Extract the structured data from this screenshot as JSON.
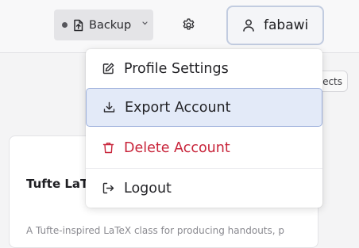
{
  "header": {
    "backup_label": "Backup",
    "user_name": "fabawi"
  },
  "toolbar": {
    "projects_label_partial": "ects"
  },
  "card": {
    "title": "Tufte LaTeX",
    "description": "A Tufte-inspired LaTeX class for producing handouts, p"
  },
  "menu": {
    "items": [
      {
        "label": "Profile Settings",
        "icon": "edit-icon"
      },
      {
        "label": "Export Account",
        "icon": "download-icon"
      },
      {
        "label": "Delete Account",
        "icon": "trash-icon"
      },
      {
        "label": "Logout",
        "icon": "logout-icon"
      }
    ]
  },
  "colors": {
    "accent_border": "#c2cce0",
    "active_bg": "#e3eaf8",
    "danger": "#c8243a"
  }
}
